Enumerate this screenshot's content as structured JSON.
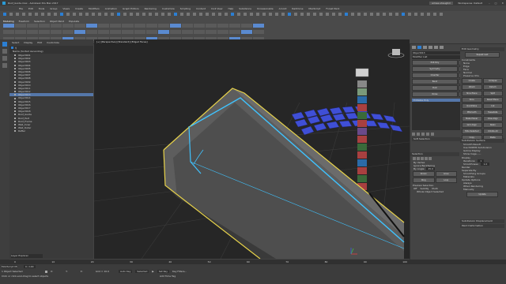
{
  "title_bar": {
    "text": "Roof_Guide.max - Autodesk 3ds Max 2017",
    "sign_in": "aimee.shaughm",
    "workspace": "Workspaces: Default"
  },
  "menu": [
    "File",
    "Edit",
    "Tools",
    "Group",
    "Views",
    "Create",
    "Modifiers",
    "Animation",
    "Graph Editors",
    "Rendering",
    "Customize",
    "Scripting",
    "Content",
    "Civil View",
    "Help",
    "Substance",
    "Unreasonable",
    "Arnold",
    "RailClone",
    "MaxScript",
    "Forest Pack"
  ],
  "ribbon": {
    "panel_left": "Polygon Modeling",
    "modify_selection": "Modify Selection",
    "edit": "Edit",
    "geometry_all": "Geometry (All)",
    "polygons": "Polygons",
    "tris": "Tris",
    "properties": "Properties",
    "tabs": [
      "Modeling",
      "Freeform",
      "Selection",
      "Object Paint",
      "Populate"
    ]
  },
  "scene_explorer": {
    "tabs": [
      "Select",
      "Display",
      "Edit",
      "Customize"
    ],
    "header": "Name (Sorted Ascending)",
    "items": [
      "Object001",
      "Object002",
      "Object003",
      "Object004",
      "Object005",
      "Object006",
      "Object007",
      "Object008",
      "Object009",
      "Object010",
      "Object011",
      "Object012",
      "Object013",
      "Object014",
      "Object015",
      "Object016",
      "Object017",
      "Object018",
      "Roof_Guide",
      "Roof_Part",
      "Roof_Frame",
      "Wall_Inner",
      "Wall_Outer",
      "Rafter"
    ],
    "selected": "Object013",
    "footer_layer": "Layer Explorer"
  },
  "viewport": {
    "label": "[+] [Perspective] [Standard] [Edged Faces]"
  },
  "command_panel": {
    "name": "Object013",
    "modifier_list": "Modifier List",
    "modifiers": [
      "Edit Poly",
      "Shell",
      "Symmetry",
      "Turbosmooth",
      "Chamfer",
      "UVW Map",
      "Bend",
      "FFD 2x2x2",
      "Push",
      "Relax",
      "Noise",
      "Mirror"
    ],
    "stack": [
      "Editable Poly"
    ],
    "edit_geometry": "Edit Geometry",
    "repeat_last": "Repeat Last",
    "constraints": "Constraints",
    "constraint_opts": [
      "None",
      "Edge",
      "Face",
      "Normal"
    ],
    "preserve_uvs": "Preserve UVs",
    "create": "Create",
    "collapse": "Collapse",
    "attach": "Attach",
    "detach": "Detach",
    "slice_plane": "Slice Plane",
    "split": "Split",
    "slice": "Slice",
    "reset_plane": "Reset Plane",
    "quickslice": "QuickSlice",
    "cut": "Cut",
    "msmooth": "MSmooth",
    "tessellate": "Tessellate",
    "make_planar": "Make Planar",
    "view_align": "View Align",
    "grid_align": "Grid Align",
    "relax": "Relax",
    "hide_selected": "Hide Selected",
    "unhide_all": "Unhide All",
    "hide_unselected": "Hide Unselected",
    "copy": "Copy",
    "paste": "Paste",
    "delete_isolated": "Delete Isolated Vertices",
    "full_interactivity": "Full Interactivity",
    "subdivision_surface": "Subdivision Surface",
    "smooth_result": "Smooth Result",
    "use_nurms": "Use NURMS Subdivision",
    "isoline_display": "Isoline Display",
    "show_cage": "Show Cage......",
    "display": "Display",
    "iterations_label": "Iterations:",
    "iterations": "1",
    "smoothness_label": "Smoothness:",
    "smoothness": "1.0",
    "render": "Render",
    "separate_by": "Separate By",
    "smoothing_groups": "Smoothing Groups",
    "materials": "Materials",
    "update_options": "Update Options",
    "always": "Always",
    "when_rendering": "When Rendering",
    "manually": "Manually",
    "update": "Update",
    "subdivision_displacement": "Subdivision Displacement",
    "paint_deformation": "Paint Deformation"
  },
  "selection_rollout": {
    "title": "Selection",
    "by_vertex": "By Vertex",
    "ignore_backfacing": "Ignore Backfacing",
    "by_angle": "By Angle:",
    "angle": "45.0",
    "shrink": "Shrink",
    "grow": "Grow",
    "ring": "Ring",
    "loop": "Loop",
    "preview_selection": "Preview Selection",
    "off": "Off",
    "subobj": "SubObj",
    "multi": "Multi",
    "whole_selected": "Whole Object Selected",
    "soft_selection": "Soft Selection"
  },
  "status": {
    "object_selected": "1 Object Selected",
    "hint": "Click or click-and-drag to select objects",
    "x": "X:",
    "y": "Y:",
    "z": "Z:",
    "grid": "Grid = 10.0",
    "add_time_tag": "Add Time Tag",
    "auto_key": "Auto Key",
    "selected": "Selected",
    "set_key": "Set Key",
    "key_filters": "Key Filters...",
    "frame": "0 / 100",
    "timeline_ticks": [
      "0",
      "10",
      "20",
      "30",
      "40",
      "50",
      "60",
      "70",
      "80",
      "90",
      "100"
    ],
    "maxscript": "MAXScript Mi"
  },
  "colors": {
    "selection_yellow": "#e8d34a",
    "edge_cyan": "#3fc3ff",
    "face_blue": "#3f4fd6",
    "panel": "#444444"
  }
}
